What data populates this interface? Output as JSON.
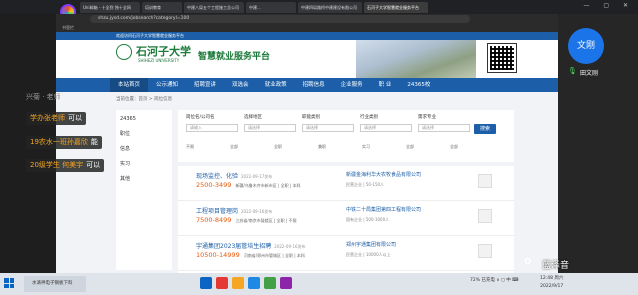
{
  "browser": {
    "tabs": [
      "Uni邮箱 - 十全到 独十全网",
      "培训教育",
      "中建八局五个工程施工总公司",
      "中建...",
      "中建四局路桥中建建设有限公司",
      "石河子大学智慧就业服务平台"
    ],
    "url": "shzu.jysd.com/jobsearch?categoryl=100",
    "bookmarks": "书签栏"
  },
  "site": {
    "topstrip": "欢迎访问石河子大学智慧就业服务平台",
    "logo_cn": "石河子大学",
    "logo_en": "SHIHEZI UNIVERSITY",
    "platform": "智慧就业服务平台",
    "nav": [
      "本站首页",
      "公示通知",
      "招聘宣讲",
      "双选会",
      "就业政策",
      "招聘信息",
      "企业服务",
      "职  业",
      "24365校"
    ],
    "breadcrumb": "当前位置：首页 > 岗位信息"
  },
  "filters": {
    "side_items": [
      "24365",
      "职位",
      "信息",
      "实习",
      "其他"
    ],
    "labels": [
      "岗位名/公司名",
      "选择地区",
      "职能类别",
      "行业类别",
      "需求专业"
    ],
    "placeholders": [
      "请输入",
      "请选择",
      "请选择",
      "请选择",
      "请选择"
    ],
    "options_row": [
      "不限",
      "全部",
      "全职",
      "兼职",
      "实习",
      "全部",
      "全部"
    ],
    "search_label": "搜索"
  },
  "jobs": [
    {
      "title": "现场监控、化验",
      "date": "2022-09-17发布",
      "salary": "2500-3499",
      "meta": "新疆/乌鲁木齐市新市区 | 全职 | 本科",
      "company": "新疆金海利华大农牧食品有限公司",
      "tags": "民营企业 | 50-150人"
    },
    {
      "title": "工程项目管理岗",
      "date": "2022-09-16发布",
      "salary": "7500-8499",
      "meta": "江苏省/南京市鼓楼区 | 全职 | 不限",
      "company": "中铁二十局集团第四工程有限公司",
      "tags": "国有企业 | 500-1000人"
    },
    {
      "title": "宇通集团2023届管培生招聘",
      "date": "2022-09-16发布",
      "salary": "10500-14999",
      "meta": "河南省/郑州市管城区 | 全职 | 本科",
      "company": "郑州宇通集团有限公司",
      "tags": "民营企业 | 10000人以上"
    }
  ],
  "meeting": {
    "speaker_initials": "文刚",
    "speaker_name": "田文刚",
    "chat": [
      {
        "who": "学办张老师",
        "msg": "可以"
      },
      {
        "who": "19农水一班孙嘉欣",
        "msg": "能"
      },
      {
        "who": "20级学生 何美宇",
        "msg": "可以"
      }
    ],
    "chat_top": "兴菊 · 老师"
  },
  "taskbar": {
    "task_label": "水滴神电子钢板下料",
    "tray": "72% 已充电 ∧ ◻ 中 ⌨",
    "time": "12:48 周六",
    "date": "2022/9/17"
  },
  "watermark": "蓝泽音",
  "colors": {
    "brand": "#1c5fa8",
    "accent": "#e8590c",
    "green": "#1c7a3b"
  }
}
